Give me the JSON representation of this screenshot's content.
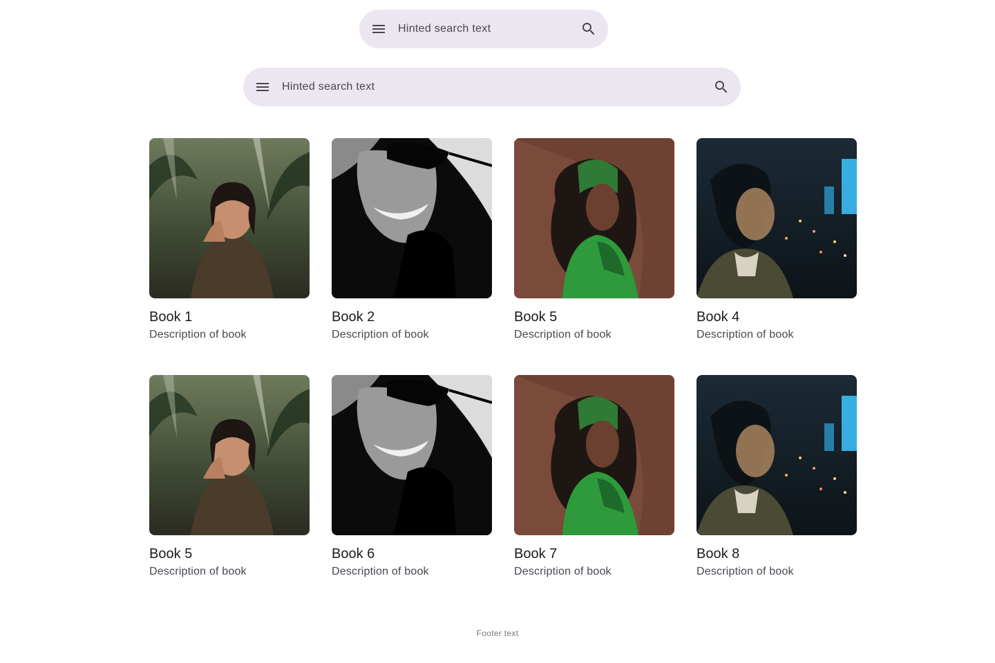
{
  "search_bars": [
    {
      "placeholder": "Hinted search text",
      "menu_icon": "menu-icon",
      "search_icon": "search-icon"
    },
    {
      "placeholder": "Hinted search text",
      "menu_icon": "menu-icon",
      "search_icon": "search-icon"
    }
  ],
  "books": [
    {
      "title": "Book 1",
      "description": "Description of book",
      "image": "woman-in-jungle-photo"
    },
    {
      "title": "Book 2",
      "description": "Description of book",
      "image": "monochrome-sunglasses-portrait-photo"
    },
    {
      "title": "Book 5",
      "description": "Description of book",
      "image": "woman-in-green-outfit-photo"
    },
    {
      "title": "Book 4",
      "description": "Description of book",
      "image": "blurred-man-city-night-photo"
    },
    {
      "title": "Book 5",
      "description": "Description of book",
      "image": "woman-in-jungle-photo"
    },
    {
      "title": "Book 6",
      "description": "Description of book",
      "image": "monochrome-sunglasses-portrait-photo"
    },
    {
      "title": "Book 7",
      "description": "Description of book",
      "image": "woman-in-green-outfit-photo"
    },
    {
      "title": "Book 8",
      "description": "Description of book",
      "image": "blurred-man-city-night-photo"
    }
  ],
  "footer": {
    "text": "Footer text"
  },
  "colors": {
    "search_bar_bg": "#ECE6F0",
    "on_surface": "#1D1B20",
    "on_surface_variant": "#49454F",
    "footer_text": "#79747E"
  }
}
